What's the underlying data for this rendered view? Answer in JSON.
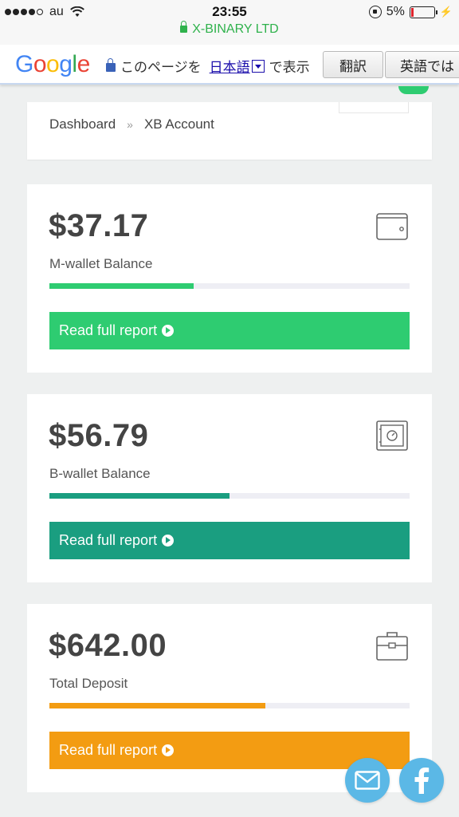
{
  "status_bar": {
    "carrier": "au",
    "time": "23:55",
    "site": "X-BINARY LTD",
    "battery": "5%",
    "battery_level": 0.05
  },
  "translate_bar": {
    "logo": "Google",
    "message_prefix": "このページを",
    "language": "日本語",
    "message_suffix": "で表示",
    "translate_button": "翻訳",
    "english_button": "英語では"
  },
  "breadcrumb": {
    "home": "Dashboard",
    "separator": "»",
    "current": "XB Account"
  },
  "cards": [
    {
      "amount": "$37.17",
      "label": "M-wallet Balance",
      "progress": 0.4,
      "button": "Read full report",
      "color": "#2ecc71",
      "icon": "wallet-icon"
    },
    {
      "amount": "$56.79",
      "label": "B-wallet Balance",
      "progress": 0.5,
      "button": "Read full report",
      "color": "#1a9e80",
      "icon": "safe-icon"
    },
    {
      "amount": "$642.00",
      "label": "Total Deposit",
      "progress": 0.6,
      "button": "Read full report",
      "color": "#f39c12",
      "icon": "briefcase-icon"
    }
  ],
  "floating": {
    "mail_icon": "mail-icon",
    "facebook_icon": "facebook-icon",
    "color": "#5bb8e6"
  }
}
